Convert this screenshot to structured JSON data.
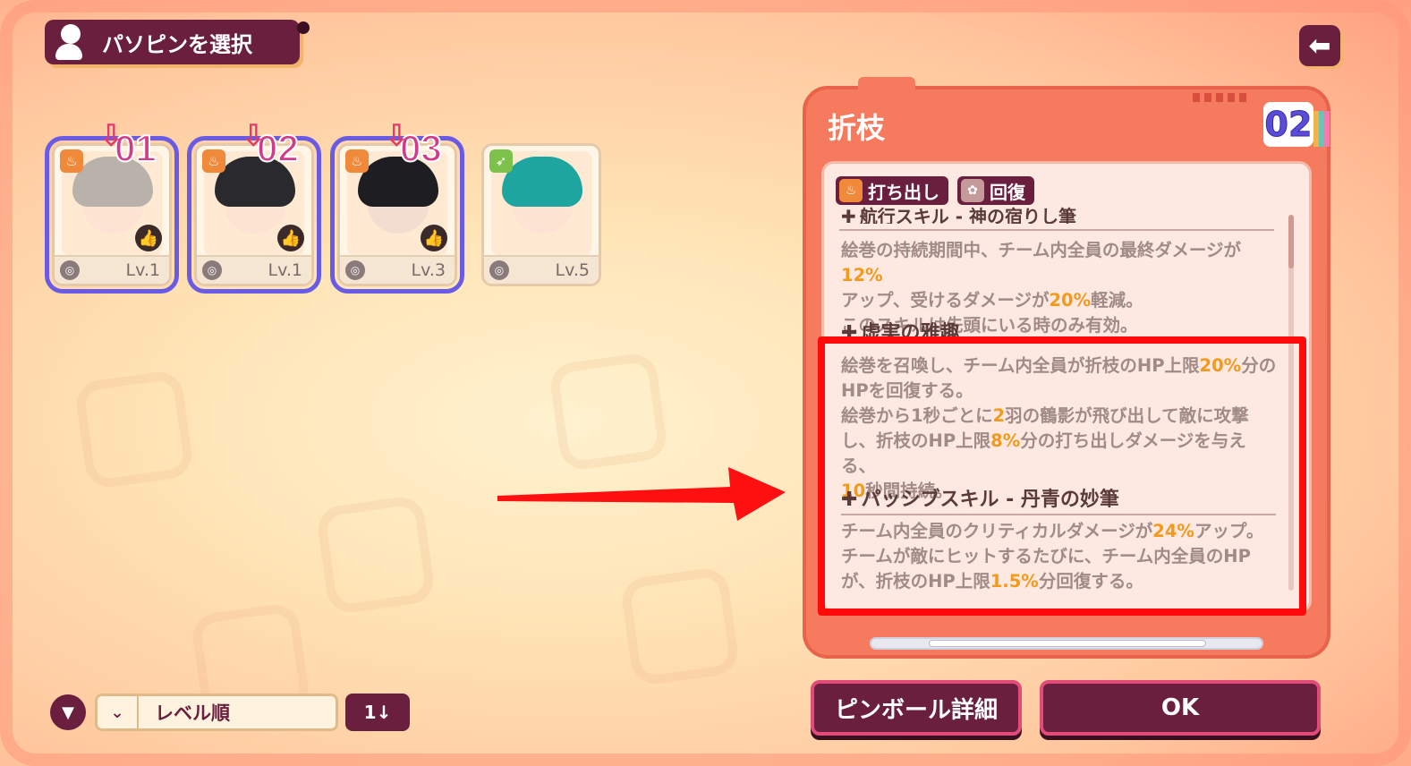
{
  "header": {
    "title": "パソピンを選択",
    "back_icon": "arrow-left-icon"
  },
  "cards": [
    {
      "slot": "01",
      "level": "Lv.1",
      "element": "fire",
      "selected": true,
      "hair": "#b8b2aa",
      "skin": "#fde3d2"
    },
    {
      "slot": "02",
      "level": "Lv.1",
      "element": "fire",
      "selected": true,
      "hair": "#2a2a2e",
      "skin": "#fde3d2"
    },
    {
      "slot": "03",
      "level": "Lv.3",
      "element": "fire",
      "selected": true,
      "hair": "#1e1e22",
      "skin": "#f3dcd0"
    },
    {
      "slot": "",
      "level": "Lv.5",
      "element": "wind",
      "selected": false,
      "hair": "#1fa5a0",
      "skin": "#fde3d2"
    }
  ],
  "detail": {
    "name": "折枝",
    "slot": "02",
    "tags": [
      {
        "label": "打ち出し",
        "icon": "flame-icon"
      },
      {
        "label": "回復",
        "icon": "heal-icon"
      }
    ],
    "partial_header": "航行スキル - 神の宿りし筆",
    "p1_a": "絵巻の持続期間中、チーム内全員の最終ダメージが",
    "p1_v1": "12%",
    "p1_b": "アップ、受けるダメージが",
    "p1_v2": "20%",
    "p1_c": "軽減。",
    "p1_d": "このスキルは先頭にいる時のみ有効。",
    "section2_header": "虚実の雅趣",
    "p2_a": "絵巻を召喚し、チーム内全員が折枝のHP上限",
    "p2_v1": "20%",
    "p2_b": "分の",
    "p2_c": "HPを回復する。",
    "p2_d": "絵巻から1秒ごとに",
    "p2_v2": "2",
    "p2_e": "羽の鶴影が飛び出して敵に攻撃",
    "p2_f": "し、折枝のHP上限",
    "p2_v3": "8%",
    "p2_g": "分の打ち出しダメージを与える、",
    "p2_v4": "10",
    "p2_h": "秒間持続。",
    "section3_header": "パッシブスキル - 丹青の妙筆",
    "p3_a": "チーム内全員のクリティカルダメージが",
    "p3_v1": "24%",
    "p3_b": "アップ。",
    "p3_c": "チームが敵にヒットするたびに、チーム内全員のHP",
    "p3_d": "が、折枝のHP上限",
    "p3_v2": "1.5%",
    "p3_e": "分回復する。"
  },
  "bottom": {
    "sort_label": "レベル順",
    "order_label": "1↓",
    "details_button": "ピンボール詳細",
    "ok_button": "OK"
  },
  "colors": {
    "accent": "#6b1f3f",
    "panel": "#f57a5e",
    "highlight": "#f39a1c",
    "selection": "#6a5be6",
    "annotation": "#ff0a0a"
  }
}
